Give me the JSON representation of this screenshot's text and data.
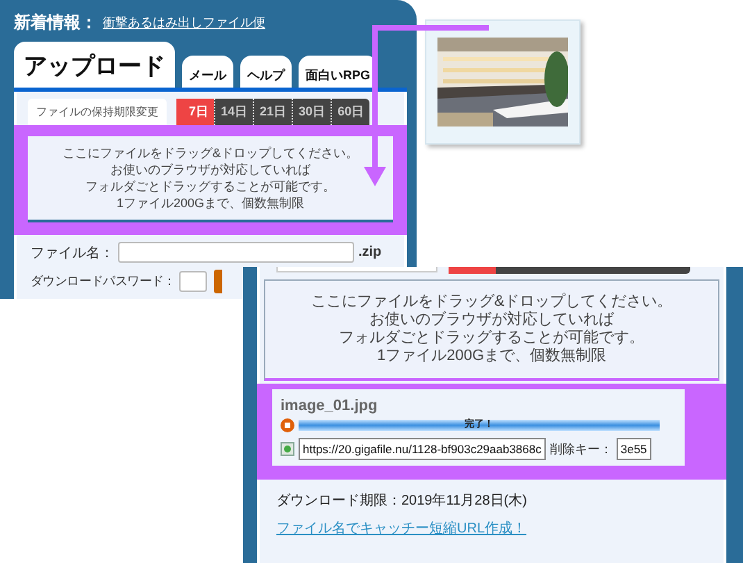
{
  "news": {
    "label": "新着情報：",
    "link": "衝撃あるはみ出しファイル便"
  },
  "tabs": [
    {
      "label": "アップロード",
      "selected": true
    },
    {
      "label": "メール",
      "selected": false
    },
    {
      "label": "ヘルプ",
      "selected": false
    },
    {
      "label": "面白いRPG",
      "selected": false
    }
  ],
  "retention": {
    "label": "ファイルの保持期限変更",
    "options": [
      {
        "label": "7日",
        "selected": true
      },
      {
        "label": "14日",
        "selected": false
      },
      {
        "label": "21日",
        "selected": false
      },
      {
        "label": "30日",
        "selected": false
      },
      {
        "label": "60日",
        "selected": false
      }
    ]
  },
  "drop_zone": {
    "lines": [
      "ここにファイルをドラッグ&ドロップしてください。",
      "お使いのブラウザが対応していれば",
      "フォルダごとドラッグすることが可能です。",
      "1ファイル200Gまで、個数無制限"
    ]
  },
  "file_name": {
    "label": "ファイル名：",
    "suffix": ".zip"
  },
  "password": {
    "label": "ダウンロードパスワード："
  },
  "result": {
    "drop_zone_lines": [
      "ここにファイルをドラッグ&ドロップしてください。",
      "お使いのブラウザが対応していれば",
      "フォルダごとドラッグすることが可能です。",
      "1ファイル200Gまで、個数無制限"
    ],
    "file": {
      "name": "image_01.jpg",
      "status": "完了！",
      "level": 1,
      "url": "https://20.gigafile.nu/1128-bf903c29aab3868c",
      "delete_key_label": "削除キー：",
      "delete_key": "3e55"
    },
    "expiry": "ダウンロード期限：2019年11月28日(木)",
    "short_url_link": "ファイル名でキャッチー短縮URL作成！"
  }
}
